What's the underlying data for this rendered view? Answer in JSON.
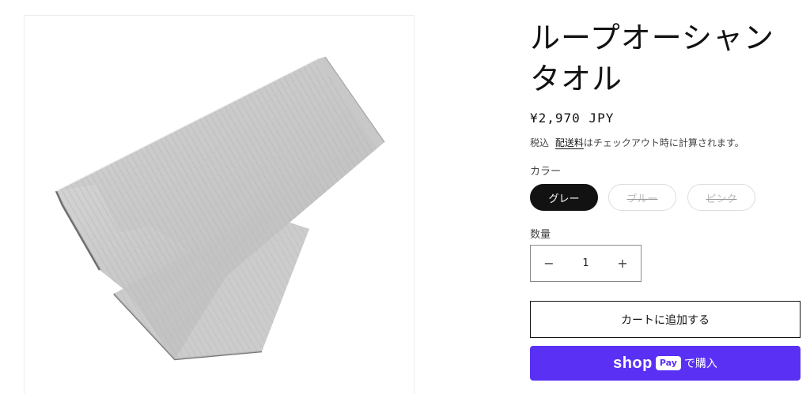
{
  "product": {
    "image_alt": "グレーのリブ編みタオル",
    "title": "ループオーシャンタオル",
    "price": "¥2,970 JPY",
    "tax_prefix": "税込",
    "shipping_link": "配送料",
    "shipping_suffix": "はチェックアウト時に計算されます。"
  },
  "variant": {
    "label": "カラー",
    "options": [
      {
        "label": "グレー",
        "selected": true,
        "available": true
      },
      {
        "label": "ブルー",
        "selected": false,
        "available": false
      },
      {
        "label": "ピンク",
        "selected": false,
        "available": false
      }
    ]
  },
  "quantity": {
    "label": "数量",
    "value": "1",
    "decrease_icon": "minus-icon",
    "increase_icon": "plus-icon"
  },
  "actions": {
    "add_to_cart": "カートに追加する",
    "shop_pay_word": "shop",
    "shop_pay_badge": "Pay",
    "shop_pay_suffix": "で購入",
    "shop_pay_color": "#5a31f4"
  }
}
